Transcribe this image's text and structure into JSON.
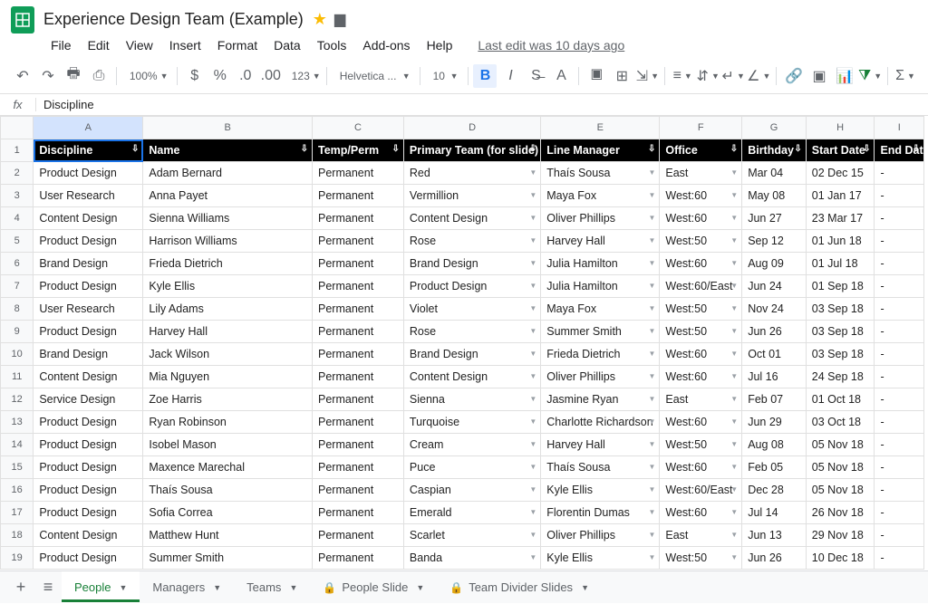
{
  "doc": {
    "title": "Experience Design Team (Example)"
  },
  "menu": {
    "file": "File",
    "edit": "Edit",
    "view": "View",
    "insert": "Insert",
    "format": "Format",
    "data": "Data",
    "tools": "Tools",
    "addons": "Add-ons",
    "help": "Help",
    "last_edit": "Last edit was 10 days ago"
  },
  "toolbar": {
    "zoom": "100%",
    "font": "Helvetica ...",
    "size": "10",
    "numfmt": "123"
  },
  "fx": {
    "value": "Discipline"
  },
  "cols": [
    "A",
    "B",
    "C",
    "D",
    "E",
    "F",
    "G",
    "H",
    "I"
  ],
  "headers": [
    "Discipline",
    "Name",
    "Temp/Perm",
    "Primary Team (for slide)",
    "Line Manager",
    "Office",
    "Birthday",
    "Start Date",
    "End Date"
  ],
  "rows": [
    {
      "n": 2,
      "d": [
        "Product Design",
        "Adam Bernard",
        "Permanent",
        "Red",
        "Thaís Sousa",
        "East",
        "Mar 04",
        "02 Dec 15",
        "-"
      ]
    },
    {
      "n": 3,
      "d": [
        "User Research",
        "Anna Payet",
        "Permanent",
        "Vermillion",
        "Maya Fox",
        "West:60",
        "May 08",
        "01 Jan 17",
        "-"
      ]
    },
    {
      "n": 4,
      "d": [
        "Content Design",
        "Sienna Williams",
        "Permanent",
        "Content Design",
        "Oliver Phillips",
        "West:60",
        "Jun 27",
        "23 Mar 17",
        "-"
      ]
    },
    {
      "n": 5,
      "d": [
        "Product Design",
        "Harrison Williams",
        "Permanent",
        "Rose",
        "Harvey Hall",
        "West:50",
        "Sep 12",
        "01 Jun 18",
        "-"
      ]
    },
    {
      "n": 6,
      "d": [
        "Brand Design",
        "Frieda Dietrich",
        "Permanent",
        "Brand Design",
        "Julia Hamilton",
        "West:60",
        "Aug 09",
        "01 Jul 18",
        "-"
      ]
    },
    {
      "n": 7,
      "d": [
        "Product Design",
        "Kyle Ellis",
        "Permanent",
        "Product Design",
        "Julia Hamilton",
        "West:60/East",
        "Jun 24",
        "01 Sep 18",
        "-"
      ]
    },
    {
      "n": 8,
      "d": [
        "User Research",
        "Lily Adams",
        "Permanent",
        "Violet",
        "Maya Fox",
        "West:50",
        "Nov 24",
        "03 Sep 18",
        "-"
      ]
    },
    {
      "n": 9,
      "d": [
        "Product Design",
        "Harvey Hall",
        "Permanent",
        "Rose",
        "Summer Smith",
        "West:50",
        "Jun 26",
        "03 Sep 18",
        "-"
      ]
    },
    {
      "n": 10,
      "d": [
        "Brand Design",
        "Jack Wilson",
        "Permanent",
        "Brand Design",
        "Frieda Dietrich",
        "West:60",
        "Oct 01",
        "03 Sep 18",
        "-"
      ]
    },
    {
      "n": 11,
      "d": [
        "Content Design",
        "Mia Nguyen",
        "Permanent",
        "Content Design",
        "Oliver Phillips",
        "West:60",
        "Jul 16",
        "24 Sep 18",
        "-"
      ]
    },
    {
      "n": 12,
      "d": [
        "Service Design",
        "Zoe Harris",
        "Permanent",
        "Sienna",
        "Jasmine Ryan",
        "East",
        "Feb 07",
        "01 Oct 18",
        "-"
      ]
    },
    {
      "n": 13,
      "d": [
        "Product Design",
        "Ryan Robinson",
        "Permanent",
        "Turquoise",
        "Charlotte Richardson",
        "West:60",
        "Jun 29",
        "03 Oct 18",
        "-"
      ]
    },
    {
      "n": 14,
      "d": [
        "Product Design",
        "Isobel Mason",
        "Permanent",
        "Cream",
        "Harvey Hall",
        "West:50",
        "Aug 08",
        "05 Nov 18",
        "-"
      ]
    },
    {
      "n": 15,
      "d": [
        "Product Design",
        "Maxence Marechal",
        "Permanent",
        "Puce",
        "Thaís Sousa",
        "West:60",
        "Feb 05",
        "05 Nov 18",
        "-"
      ]
    },
    {
      "n": 16,
      "d": [
        "Product Design",
        "Thaís Sousa",
        "Permanent",
        "Caspian",
        "Kyle Ellis",
        "West:60/East",
        "Dec 28",
        "05 Nov 18",
        "-"
      ]
    },
    {
      "n": 17,
      "d": [
        "Product Design",
        "Sofia Correa",
        "Permanent",
        "Emerald",
        "Florentin Dumas",
        "West:60",
        "Jul 14",
        "26 Nov 18",
        "-"
      ]
    },
    {
      "n": 18,
      "d": [
        "Content Design",
        "Matthew Hunt",
        "Permanent",
        "Scarlet",
        "Oliver Phillips",
        "East",
        "Jun 13",
        "29 Nov 18",
        "-"
      ]
    },
    {
      "n": 19,
      "d": [
        "Product Design",
        "Summer Smith",
        "Permanent",
        "Banda",
        "Kyle Ellis",
        "West:50",
        "Jun 26",
        "10 Dec 18",
        "-"
      ]
    }
  ],
  "tabs": [
    {
      "label": "People",
      "active": true,
      "locked": false
    },
    {
      "label": "Managers",
      "active": false,
      "locked": false
    },
    {
      "label": "Teams",
      "active": false,
      "locked": false
    },
    {
      "label": "People Slide",
      "active": false,
      "locked": true
    },
    {
      "label": "Team Divider Slides",
      "active": false,
      "locked": true
    }
  ]
}
